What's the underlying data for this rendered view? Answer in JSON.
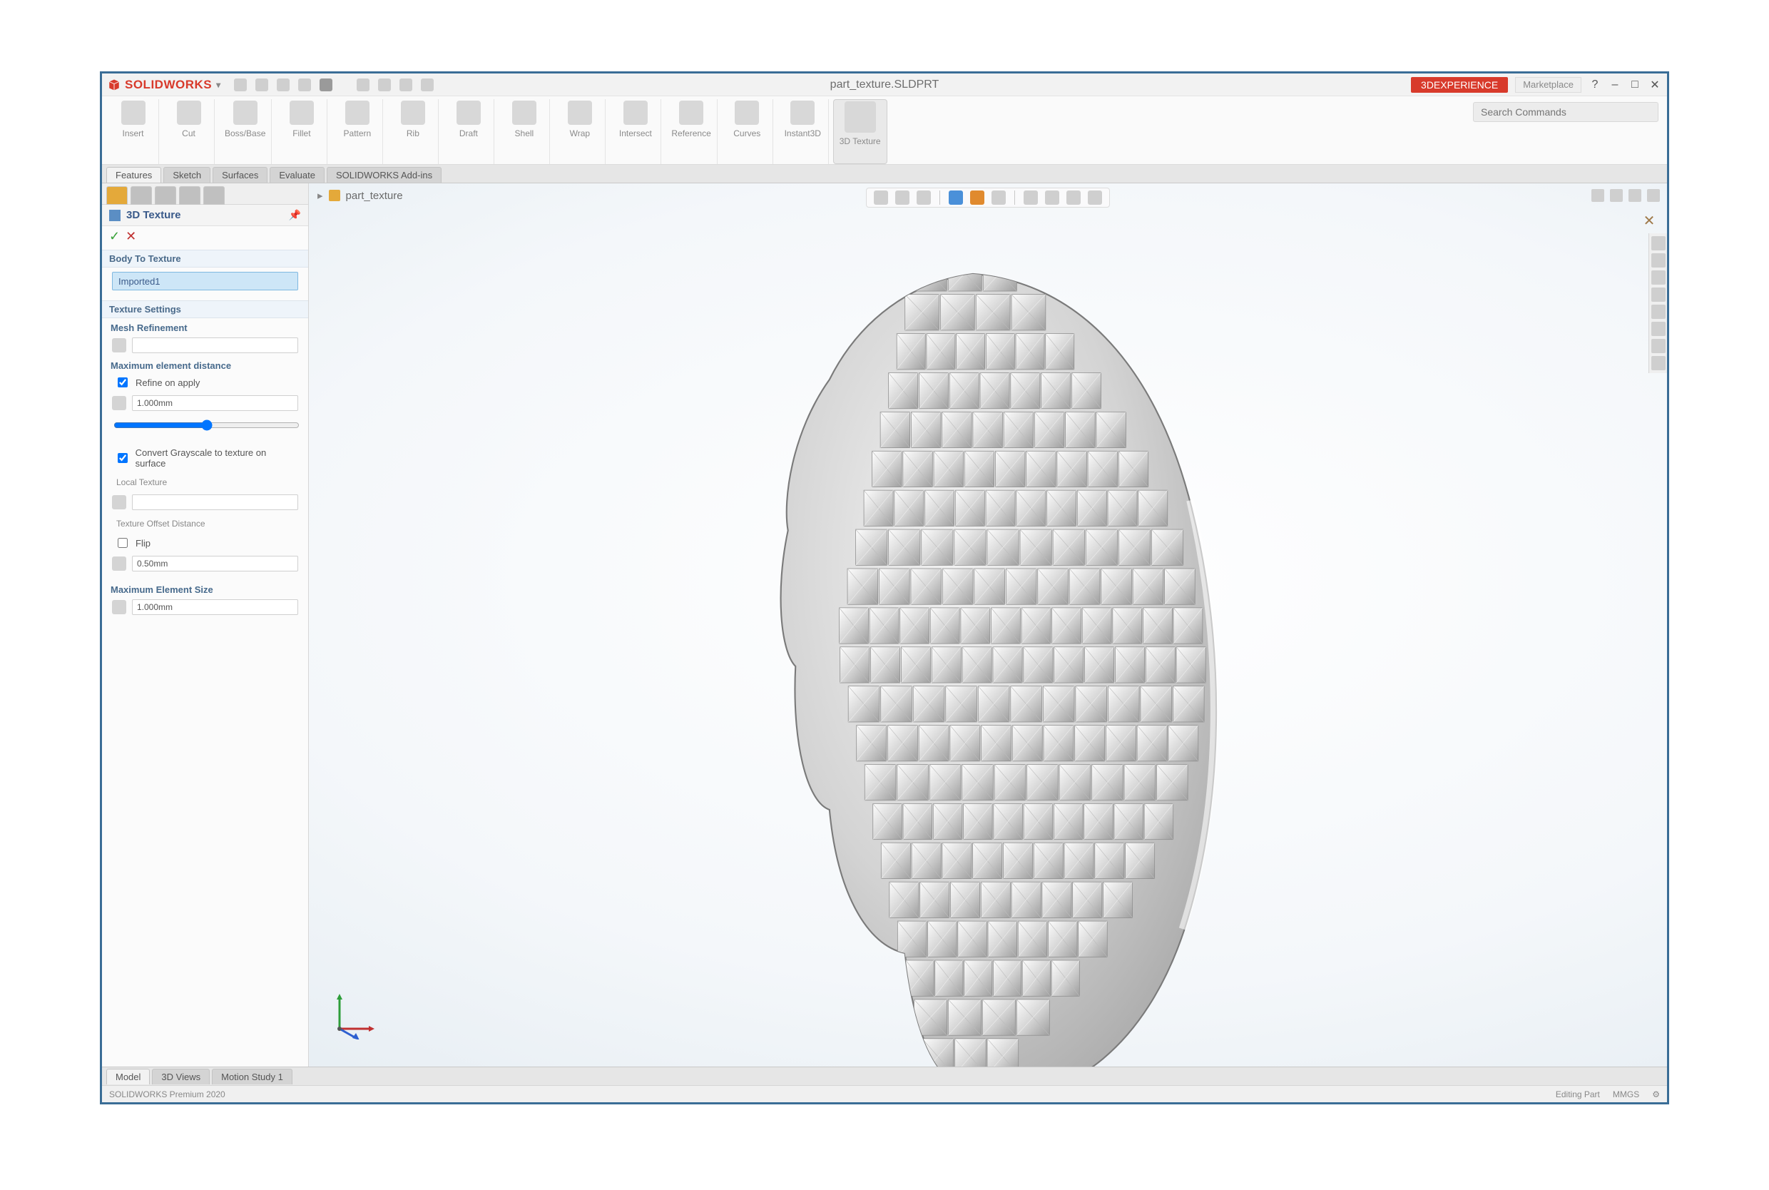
{
  "app": {
    "brand": "SOLIDWORKS",
    "document_title": "part_texture.SLDPRT",
    "banner_label": "3DEXPERIENCE",
    "banner_tail": "Marketplace",
    "search_placeholder": "Search Commands"
  },
  "window_controls": {
    "min": "–",
    "max": "□",
    "close": "✕"
  },
  "quick_access": [
    "new",
    "open",
    "save",
    "print",
    "undo",
    "redo",
    "rebuild",
    "options"
  ],
  "ribbon_groups": [
    {
      "label": "Insert"
    },
    {
      "label": "Cut"
    },
    {
      "label": "Boss/Base"
    },
    {
      "label": "Fillet"
    },
    {
      "label": "Pattern"
    },
    {
      "label": "Rib"
    },
    {
      "label": "Draft"
    },
    {
      "label": "Shell"
    },
    {
      "label": "Wrap"
    },
    {
      "label": "Intersect"
    },
    {
      "label": "Reference"
    },
    {
      "label": "Curves"
    },
    {
      "label": "Instant3D"
    },
    {
      "label": "3D Texture",
      "highlight": true
    }
  ],
  "ribbon_tabs": [
    "Features",
    "Sketch",
    "Surfaces",
    "Evaluate",
    "SOLIDWORKS Add-ins"
  ],
  "active_ribbon_tab_index": 0,
  "hud_buttons": [
    "zoom-fit",
    "zoom-area",
    "prev-view",
    "section",
    "view-orient",
    "display-style",
    "hide-show",
    "appearance",
    "scene",
    "view-settings"
  ],
  "corner_buttons": [
    "collapse",
    "split",
    "max",
    "close"
  ],
  "side_buttons": [
    "appearances",
    "decals",
    "scenes",
    "lights",
    "camera",
    "walk",
    "display",
    "selection"
  ],
  "breadcrumb": {
    "part": "part_texture"
  },
  "pm": {
    "title": "3D Texture",
    "tabs": [
      "feature",
      "config",
      "display",
      "dim",
      "study"
    ],
    "ok": "✓",
    "cancel": "✕",
    "help": "?",
    "section_body": "Body To Texture",
    "body_selected": "Imported1",
    "section_settings": "Texture Settings",
    "group_mesh": "Mesh Refinement",
    "group_distance": "Maximum element distance",
    "check_refine": "Refine on apply",
    "distance_value": "1.000mm",
    "group_distort": "Convert Grayscale to texture on surface",
    "label_texture": "Local Texture",
    "label_offset": "Texture Offset Distance",
    "check_flip": "Flip",
    "offset_value": "0.50mm",
    "group_max": "Maximum Element Size",
    "max_value": "1.000mm"
  },
  "doc_tabs": [
    "Model",
    "3D Views",
    "Motion Study 1"
  ],
  "status": {
    "left": "SOLIDWORKS Premium 2020",
    "mid": "Editing Part",
    "units": "MMGS"
  }
}
